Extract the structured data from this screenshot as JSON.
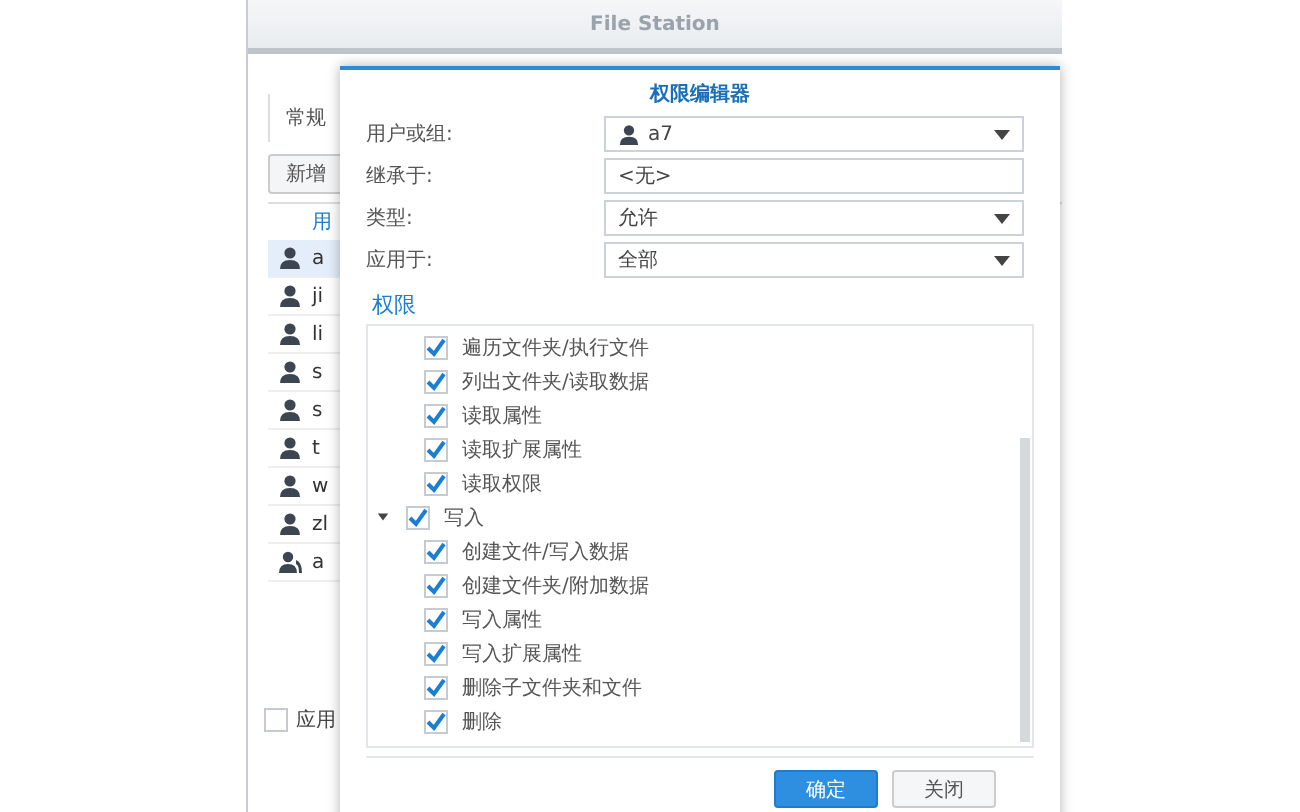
{
  "window": {
    "title": "File Station"
  },
  "background_panel": {
    "tab": "常规",
    "add_button": "新增",
    "column_1": "用",
    "rows": [
      {
        "name": "a",
        "kind": "user",
        "selected": true
      },
      {
        "name": "ji",
        "kind": "user",
        "selected": false
      },
      {
        "name": "li",
        "kind": "user",
        "selected": false
      },
      {
        "name": "s",
        "kind": "user",
        "selected": false
      },
      {
        "name": "s",
        "kind": "user",
        "selected": false
      },
      {
        "name": "t",
        "kind": "user",
        "selected": false
      },
      {
        "name": "w",
        "kind": "user",
        "selected": false
      },
      {
        "name": "zl",
        "kind": "user",
        "selected": false
      },
      {
        "name": "a",
        "kind": "group",
        "selected": false
      }
    ],
    "apply_checkbox": {
      "label": "应用",
      "checked": false
    }
  },
  "dialog": {
    "title": "权限编辑器",
    "fields": [
      {
        "label": "用户或组:",
        "value": "a7",
        "kind": "user-dropdown"
      },
      {
        "label": "继承于:",
        "value": "<无>",
        "kind": "text"
      },
      {
        "label": "类型:",
        "value": "允许",
        "kind": "dropdown"
      },
      {
        "label": "应用于:",
        "value": "全部",
        "kind": "dropdown"
      }
    ],
    "section": "权限",
    "permissions": [
      {
        "label": "遍历文件夹/执行文件",
        "checked": true
      },
      {
        "label": "列出文件夹/读取数据",
        "checked": true
      },
      {
        "label": "读取属性",
        "checked": true
      },
      {
        "label": "读取扩展属性",
        "checked": true
      },
      {
        "label": "读取权限",
        "checked": true
      },
      {
        "label": "写入",
        "checked": true,
        "expanded": true,
        "children": [
          {
            "label": "创建文件/写入数据",
            "checked": true
          },
          {
            "label": "创建文件夹/附加数据",
            "checked": true
          },
          {
            "label": "写入属性",
            "checked": true
          },
          {
            "label": "写入扩展属性",
            "checked": true
          },
          {
            "label": "删除子文件夹和文件",
            "checked": true
          },
          {
            "label": "删除",
            "checked": true
          }
        ]
      }
    ],
    "buttons": [
      {
        "label": "确定",
        "kind": "primary"
      },
      {
        "label": "关闭",
        "kind": "secondary"
      }
    ]
  }
}
